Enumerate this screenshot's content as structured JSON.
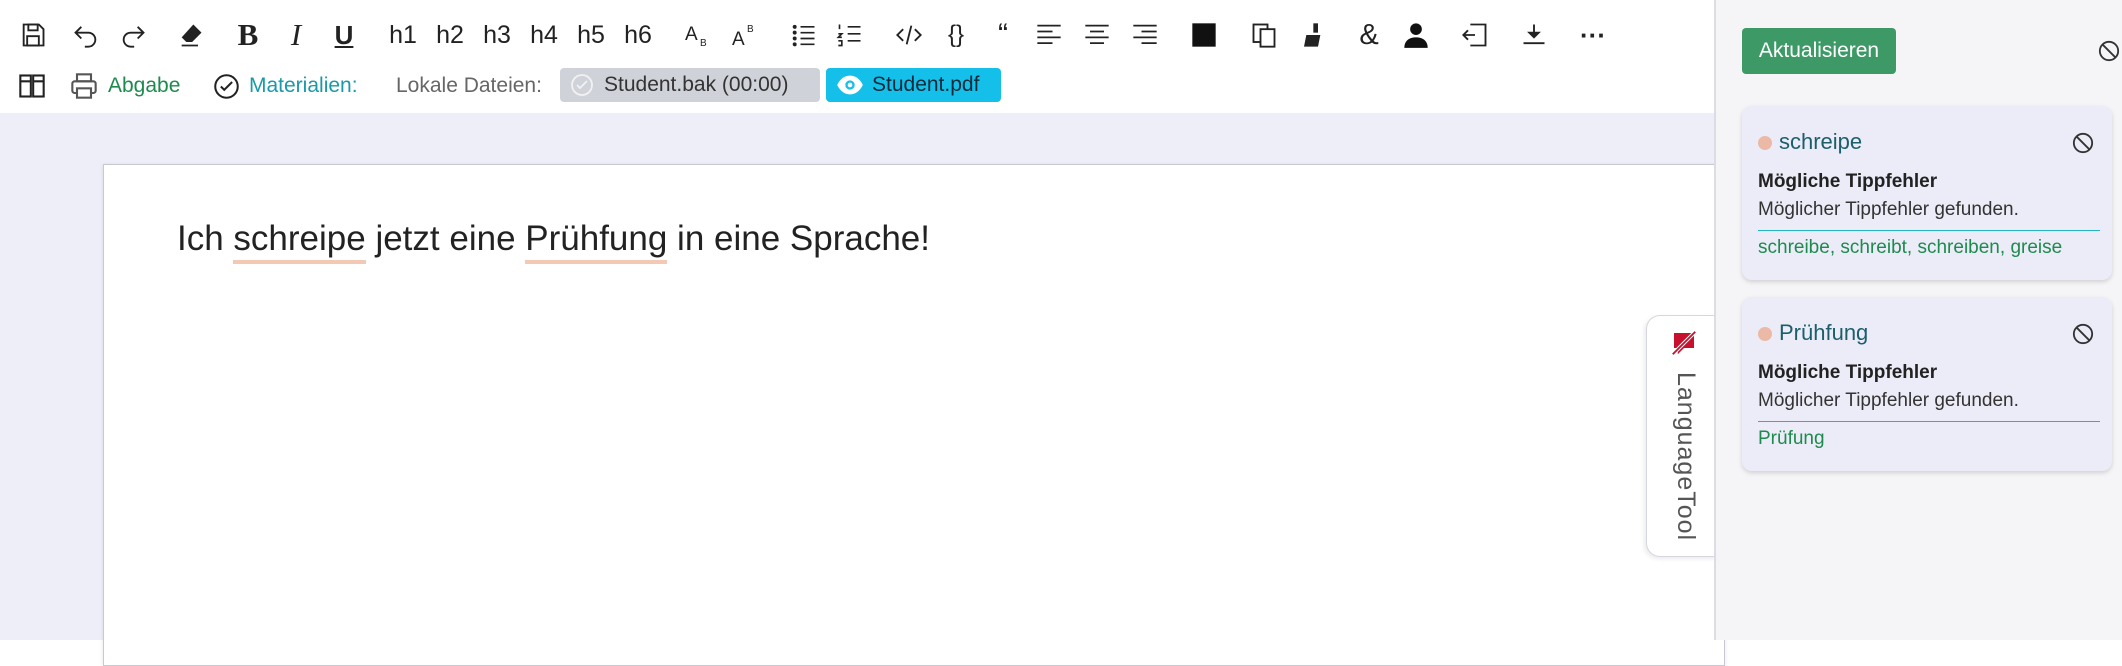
{
  "toolbar": {
    "row1": [
      {
        "name": "save-icon",
        "kind": "icon"
      },
      {
        "name": "undo-icon",
        "kind": "icon"
      },
      {
        "name": "redo-icon",
        "kind": "icon"
      },
      {
        "name": "eraser-icon",
        "kind": "icon"
      },
      {
        "name": "bold-button",
        "kind": "text",
        "label": "B"
      },
      {
        "name": "italic-button",
        "kind": "text",
        "label": "I"
      },
      {
        "name": "underline-button",
        "kind": "text",
        "label": "U"
      },
      {
        "name": "h1-button",
        "kind": "text",
        "label": "h1"
      },
      {
        "name": "h2-button",
        "kind": "text",
        "label": "h2"
      },
      {
        "name": "h3-button",
        "kind": "text",
        "label": "h3"
      },
      {
        "name": "h4-button",
        "kind": "text",
        "label": "h4"
      },
      {
        "name": "h5-button",
        "kind": "text",
        "label": "h5"
      },
      {
        "name": "h6-button",
        "kind": "text",
        "label": "h6"
      },
      {
        "name": "subscript-icon",
        "kind": "icon"
      },
      {
        "name": "superscript-icon",
        "kind": "icon"
      },
      {
        "name": "bullet-list-icon",
        "kind": "icon"
      },
      {
        "name": "numbered-list-icon",
        "kind": "icon"
      },
      {
        "name": "code-icon",
        "kind": "icon"
      },
      {
        "name": "braces-button",
        "kind": "text",
        "label": "{}"
      },
      {
        "name": "quote-button",
        "kind": "text",
        "label": "“"
      },
      {
        "name": "align-left-icon",
        "kind": "icon"
      },
      {
        "name": "align-center-icon",
        "kind": "icon"
      },
      {
        "name": "align-right-icon",
        "kind": "icon"
      },
      {
        "name": "black-square-icon",
        "kind": "icon"
      },
      {
        "name": "copy-icon",
        "kind": "icon"
      },
      {
        "name": "brush-icon",
        "kind": "icon"
      },
      {
        "name": "ampersand-button",
        "kind": "text",
        "label": "&"
      },
      {
        "name": "person-icon",
        "kind": "icon"
      },
      {
        "name": "enter-icon",
        "kind": "icon"
      },
      {
        "name": "download-icon",
        "kind": "icon"
      },
      {
        "name": "more-button",
        "kind": "text",
        "label": "···"
      }
    ],
    "abgabe_label": "Abgabe",
    "materialien_label": "Materialien:",
    "lokale_dateien_label": "Lokale Dateien:",
    "file_bak": "Student.bak (00:00)",
    "file_pdf": "Student.pdf"
  },
  "document": {
    "before1": "Ich ",
    "err1": "schreipe",
    "between": " jetzt eine ",
    "err2": "Prühfung",
    "after": " in eine Sprache!"
  },
  "languagetool": {
    "tab_label": "LanguageTool"
  },
  "sidebar": {
    "update_button": "Aktualisieren",
    "cards": [
      {
        "word": "schreipe",
        "title": "Mögliche Tippfehler",
        "description": "Möglicher Tippfehler gefunden.",
        "suggestions": [
          "schreibe",
          "schreibt",
          "schreiben",
          "greise"
        ]
      },
      {
        "word": "Prühfung",
        "title": "Mögliche Tippfehler",
        "description": "Möglicher Tippfehler gefunden.",
        "suggestions": [
          "Prüfung"
        ]
      }
    ]
  },
  "colors": {
    "accent_green": "#3d9a67",
    "link_green": "#1d8a4e",
    "teal": "#1a9aa8",
    "pdf_chip": "#14c0ea",
    "error_underline": "#f3c9b5",
    "card_bg": "#ececf8"
  }
}
